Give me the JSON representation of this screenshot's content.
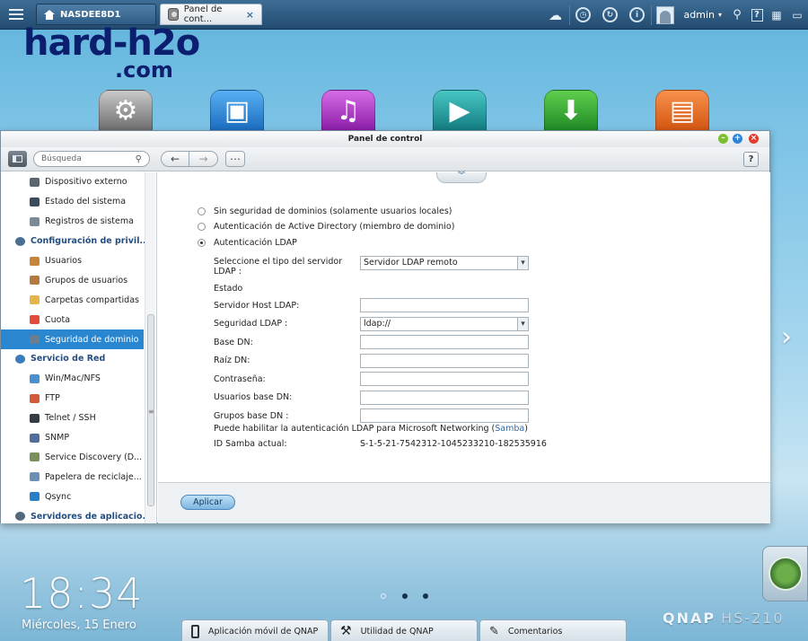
{
  "taskbar": {
    "home_tab": "NASDEE8D1",
    "active_tab": "Panel de cont...",
    "tab_close": "×",
    "user": "admin",
    "icons": [
      "menu-icon",
      "home-icon",
      "cloud-icon",
      "clock-icon",
      "refresh-icon",
      "info-icon",
      "avatar-icon",
      "search-icon",
      "help-icon",
      "grid-icon",
      "monitor-icon"
    ]
  },
  "watermark": {
    "line1": "hard-h2o",
    "line2": ".com"
  },
  "desktop_apps": [
    {
      "name": "control-panel",
      "color": "#8c8c8c"
    },
    {
      "name": "photo-station",
      "color": "#2e86d4"
    },
    {
      "name": "music-station",
      "color": "#b133c3"
    },
    {
      "name": "video-station",
      "color": "#1c9a9b"
    },
    {
      "name": "download-station",
      "color": "#2f9f34"
    },
    {
      "name": "file-station",
      "color": "#e56b1c"
    }
  ],
  "window": {
    "title": "Panel de control",
    "search_placeholder": "Búsqueda",
    "help": "?",
    "nav_back": "←",
    "nav_forward": "→",
    "nav_grid": "⋯"
  },
  "sidebar": [
    {
      "label": "Dispositivo externo",
      "type": "item",
      "color": "#5a6570"
    },
    {
      "label": "Estado del sistema",
      "type": "item",
      "color": "#3a4b5c"
    },
    {
      "label": "Registros de sistema",
      "type": "item",
      "color": "#7c8a96"
    },
    {
      "label": "Configuración de privil...",
      "type": "cat",
      "color": "#4a6f93"
    },
    {
      "label": "Usuarios",
      "type": "item",
      "color": "#c8843b"
    },
    {
      "label": "Grupos de usuarios",
      "type": "item",
      "color": "#b47a3d"
    },
    {
      "label": "Carpetas compartidas",
      "type": "item",
      "color": "#e3b54a"
    },
    {
      "label": "Cuota",
      "type": "item",
      "color": "#e24a3a"
    },
    {
      "label": "Seguridad de dominio",
      "type": "item",
      "color": "#6a7d91",
      "selected": true
    },
    {
      "label": "Servicio de Red",
      "type": "cat",
      "color": "#3c7bbd"
    },
    {
      "label": "Win/Mac/NFS",
      "type": "item",
      "color": "#4a8fcf"
    },
    {
      "label": "FTP",
      "type": "item",
      "color": "#d25a3b"
    },
    {
      "label": "Telnet / SSH",
      "type": "item",
      "color": "#333b44"
    },
    {
      "label": "SNMP",
      "type": "item",
      "color": "#4f6f9a"
    },
    {
      "label": "Service Discovery (D...",
      "type": "item",
      "color": "#7b8f5a"
    },
    {
      "label": "Papelera de reciclaje...",
      "type": "item",
      "color": "#6c8fb5"
    },
    {
      "label": "Qsync",
      "type": "item",
      "color": "#2a7fc9"
    },
    {
      "label": "Servidores de aplicacio...",
      "type": "cat",
      "color": "#55697d"
    }
  ],
  "content": {
    "options": [
      {
        "label": "Sin seguridad de dominios (solamente usuarios locales)",
        "checked": false
      },
      {
        "label": "Autenticación de Active Directory (miembro de dominio)",
        "checked": false
      },
      {
        "label": "Autenticación LDAP",
        "checked": true
      }
    ],
    "fields": [
      {
        "label": "Seleccione el tipo del servidor LDAP :",
        "value": "Servidor LDAP remoto",
        "kind": "select"
      },
      {
        "label": "Estado",
        "value": "",
        "kind": "none"
      },
      {
        "label": "Servidor Host LDAP:",
        "value": "",
        "kind": "input"
      },
      {
        "label": "Seguridad LDAP :",
        "value": "ldap://",
        "kind": "select"
      },
      {
        "label": "Base DN:",
        "value": "",
        "kind": "input"
      },
      {
        "label": "Raíz DN:",
        "value": "",
        "kind": "input"
      },
      {
        "label": "Contraseña:",
        "value": "",
        "kind": "input"
      },
      {
        "label": "Usuarios base DN:",
        "value": "",
        "kind": "input"
      },
      {
        "label": "Grupos base DN :",
        "value": "",
        "kind": "input"
      }
    ],
    "samba_note_prefix": "Puede habilitar la autenticación LDAP para Microsoft Networking (",
    "samba_link": "Samba",
    "samba_note_suffix": ")",
    "samba_id_label": "ID Samba actual:",
    "samba_id_value": "S-1-5-21-7542312-1045233210-182535916",
    "apply": "Aplicar"
  },
  "desktop": {
    "time": "18:34",
    "date": "Miércoles, 15 Enero",
    "pages": 3,
    "current_page": 1,
    "bottom_buttons": [
      "Aplicación móvil de QNAP",
      "Utilidad de QNAP",
      "Comentarios"
    ],
    "brand": "QNAP",
    "model": "HS-210"
  }
}
